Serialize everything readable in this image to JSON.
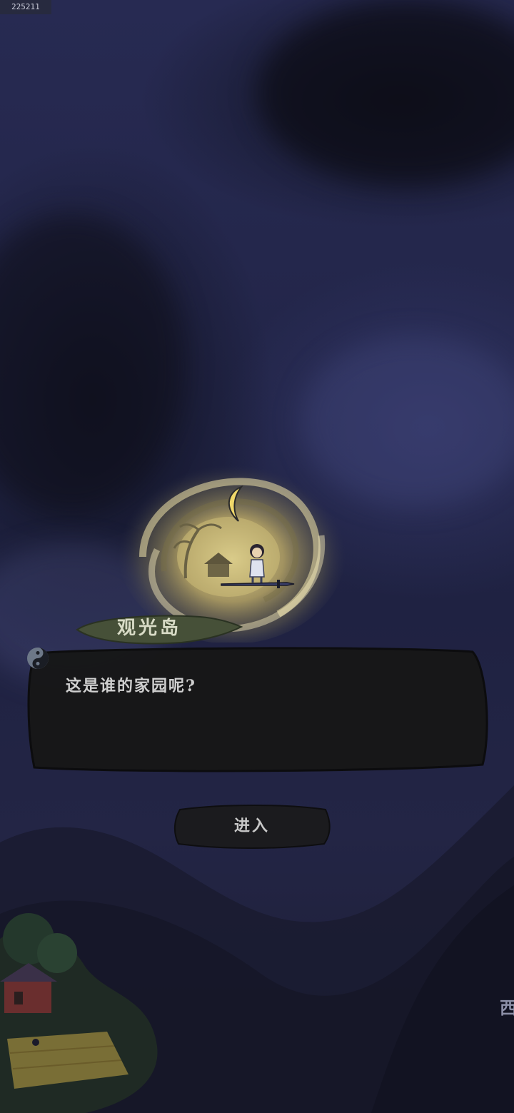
{
  "debug": {
    "counter": "225211"
  },
  "location": {
    "name": "观光岛"
  },
  "dialog": {
    "text": "这是谁的家园呢?"
  },
  "actions": {
    "enter_label": "进入"
  },
  "edge": {
    "partial_label": "西"
  },
  "icons": {
    "dialog_next": "swirl-icon",
    "portal": "golden-vortex-icon",
    "moon": "crescent-moon-icon"
  },
  "colors": {
    "background": "#23264a",
    "portal_glow": "#e8d68a",
    "tag_green": "#46503a",
    "dialog_bg": "#161616",
    "text_light": "#d8dbc6"
  }
}
